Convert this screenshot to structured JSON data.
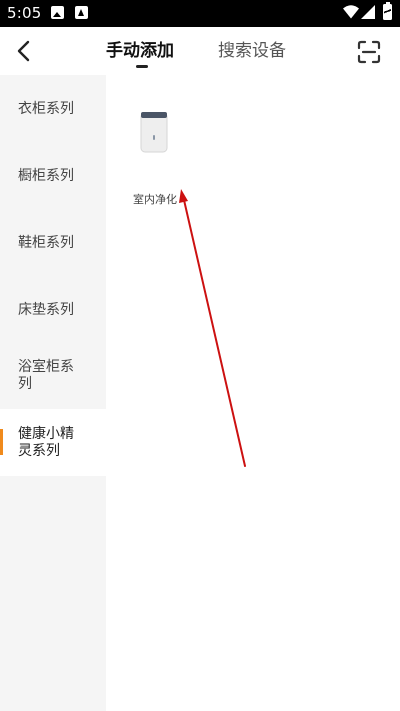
{
  "status_bar": {
    "time": "5:05",
    "icons": [
      "image-icon",
      "a-app-icon",
      "wifi-icon",
      "signal-icon",
      "battery-charging-icon"
    ]
  },
  "header": {
    "tabs": [
      {
        "label": "手动添加",
        "active": true
      },
      {
        "label": "搜索设备",
        "active": false
      }
    ],
    "back_icon": "chevron-left-icon",
    "scan_icon": "scan-icon"
  },
  "sidebar": {
    "items": [
      {
        "label": "衣柜系列",
        "active": false
      },
      {
        "label": "橱柜系列",
        "active": false
      },
      {
        "label": "鞋柜系列",
        "active": false
      },
      {
        "label": "床垫系列",
        "active": false
      },
      {
        "label": "浴室柜系列",
        "active": false
      },
      {
        "label": "健康小精灵系列",
        "active": true
      }
    ],
    "active_color": "#f08a1c"
  },
  "devices": [
    {
      "label": "室内净化",
      "icon": "air-purifier-icon"
    }
  ],
  "annotation": {
    "color": "#cc1111"
  }
}
